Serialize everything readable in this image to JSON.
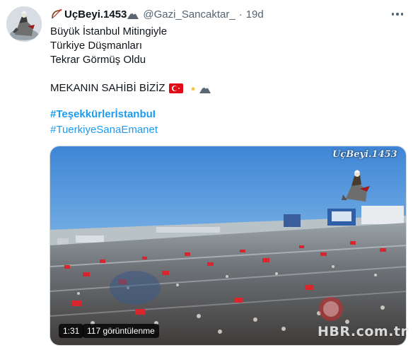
{
  "author": {
    "display_name": "UçBeyi.1453",
    "handle": "@Gazi_Sancaktar_",
    "separator": "·",
    "timestamp": "19d",
    "name_emoji": "bow-and-arrow-icon",
    "suffix_emoji": "mountain-icon"
  },
  "tweet": {
    "lines": [
      "Büyük İstanbul Mitingiyle",
      "Türkiye Düşmanları",
      "Tekrar Görmüş Oldu"
    ],
    "statement": "MEKANIN SAHİBİ BİZİZ",
    "hashtags": [
      "#TeşekkürlerİstanbuI",
      "#TuerkiyeSanaEmanet"
    ]
  },
  "media": {
    "type": "video",
    "duration": "1:31",
    "views": "117 görüntülenme",
    "overlay_watermark": "UçBeyi.1453",
    "corner_watermark": "HBR.com.tr"
  },
  "colors": {
    "accent": "#1d9bf0",
    "secondary_text": "#536471",
    "primary_text": "#0f1419",
    "turkish_flag_red": "#e30a17"
  }
}
